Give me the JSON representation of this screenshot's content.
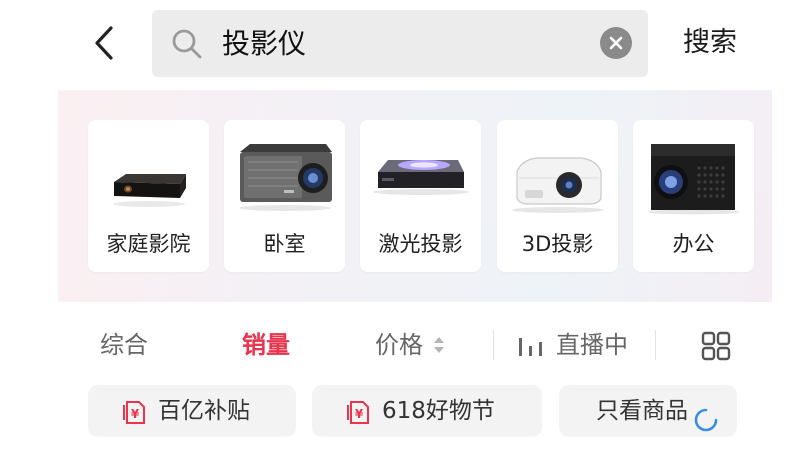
{
  "header": {
    "search": {
      "query": "投影仪",
      "button_label": "搜索"
    }
  },
  "categories": [
    {
      "label": "家庭影院",
      "icon": "mini-projector-image"
    },
    {
      "label": "卧室",
      "icon": "portable-projector-image"
    },
    {
      "label": "激光投影",
      "icon": "laser-projector-image"
    },
    {
      "label": "3D投影",
      "icon": "3d-projector-image"
    },
    {
      "label": "办公",
      "icon": "office-projector-image"
    }
  ],
  "sort_tabs": {
    "comprehensive": "综合",
    "sales": "销量",
    "price": "价格",
    "live": "直播中",
    "active": "sales"
  },
  "filter_chips": {
    "subsidy": "百亿补贴",
    "festival": "618好物节",
    "goods_only": "只看商品"
  },
  "colors": {
    "accent": "#e8344e",
    "chip_background": "#f3f3f3",
    "search_background": "#ececec"
  }
}
